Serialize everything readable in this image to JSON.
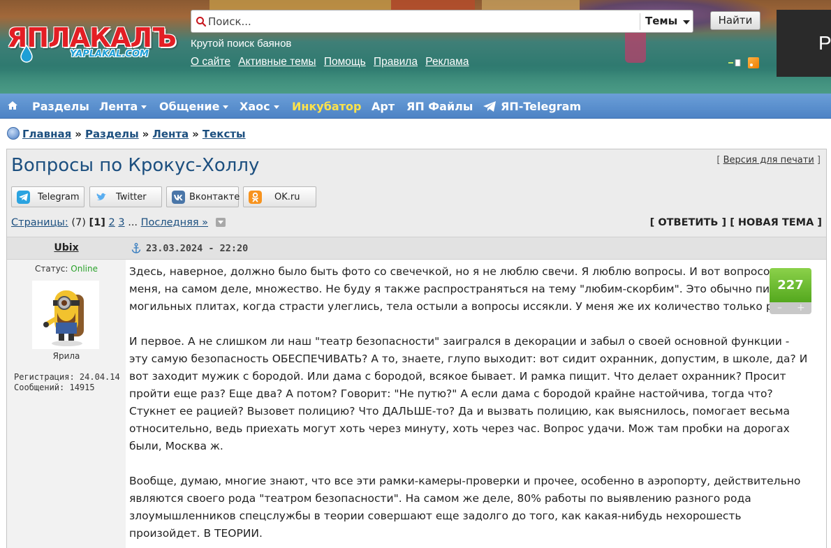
{
  "header": {
    "logo_text": "ЯПЛАКАЛЪ",
    "logo_subtext": "YAPLAKAL.COM",
    "search_placeholder": "Поиск...",
    "search_scope": "Темы",
    "find_button": "Найти",
    "tagline": "Крутой поиск баянов",
    "links": [
      "О сайте",
      "Активные темы",
      "Помощь",
      "Правила",
      "Реклама"
    ],
    "side_ad_letter": "Р"
  },
  "nav": {
    "items": [
      {
        "label": "Разделы",
        "dropdown": false
      },
      {
        "label": "Лента",
        "dropdown": true
      },
      {
        "label": "Общение",
        "dropdown": true
      },
      {
        "label": "Хаос",
        "dropdown": true
      },
      {
        "label": "Инкубатор",
        "dropdown": false,
        "highlight": "#ffe34a"
      },
      {
        "label": "Арт",
        "dropdown": false
      },
      {
        "label": "ЯП Файлы",
        "dropdown": false
      },
      {
        "label": "ЯП-Telegram",
        "dropdown": false
      }
    ]
  },
  "breadcrumb": [
    "Главная",
    "Разделы",
    "Лента",
    "Тексты"
  ],
  "topic": {
    "title": "Вопросы по Крокус-Холлу",
    "print_link": "Версия для печати",
    "share": [
      {
        "label": "Telegram",
        "icon": "telegram-icon",
        "color": "#2aa3e0"
      },
      {
        "label": "Twitter",
        "icon": "twitter-icon",
        "color": "#5aaef0"
      },
      {
        "label": "Вконтакте",
        "icon": "vk-icon",
        "color": "#4a76a8"
      },
      {
        "label": "OK.ru",
        "icon": "ok-icon",
        "color": "#f7931e"
      }
    ],
    "pages_label": "Страницы:",
    "pages_total": "(7)",
    "current_page": "1",
    "page_links": [
      "2",
      "3"
    ],
    "pages_ellipsis": "...",
    "last_page": "Последняя »",
    "reply": "ОТВЕТИТЬ",
    "new_topic": "НОВАЯ ТЕМА"
  },
  "post": {
    "author": "Ubix",
    "status_label": "Статус:",
    "status_value": "Online",
    "rank": "Ярила",
    "registration": "Регистрация: 24.04.14",
    "messages": "Сообщений: 14915",
    "date": "23.03.2024 - 22:20",
    "rating": "227",
    "rating_minus": "–",
    "rating_plus": "+",
    "paragraphs": [
      "Здесь, наверное, должно было быть фото со свечечкой, но я не люблю свечи. Я люблю вопросы. И вот вопросов у меня, на самом деле, множество. Не буду я также распространяться на тему \"любим-скорбим\". Это обычно пишут на могильных плитах, когда страсти улеглись, тела остыли а вопросы иссякли. У меня же их количество только растет.",
      "И первое. А не слишком ли наш \"театр безопасности\" заигрался в декорации и забыл о своей основной функции - эту самую безопасность ОБЕСПЕЧИВАТЬ? А то, знаете, глупо выходит: вот сидит охранник, допустим, в школе, да? И вот заходит мужик с бородой. Или дама с бородой, всякое бывает. И рамка пищит. Что делает охранник? Просит пройти еще раз? Еще два? А потом? Говорит: \"Не путю?\" А если дама с бородой крайне настойчива, тогда что? Стукнет ее рацией? Вызовет полицию? Что ДАЛЬШЕ-то? Да и вызвать полицию, как выяснилось, помогает весьма относительно, ведь приехать могут хоть через минуту, хоть через час. Вопрос удачи. Мож там пробки на дорогах были, Москва ж.",
      "Вообще, думаю, многие знают, что все эти рамки-камеры-проверки и прочее, особенно в аэропорту, действительно являются своего рода \"театром безопасности\". На самом же деле, 80% работы по выявлению разного рода злоумышленников спецслужбы в теории совершают еще задолго до того, как какая-нибудь нехорошесть произойдет. В ТЕОРИИ."
    ]
  }
}
